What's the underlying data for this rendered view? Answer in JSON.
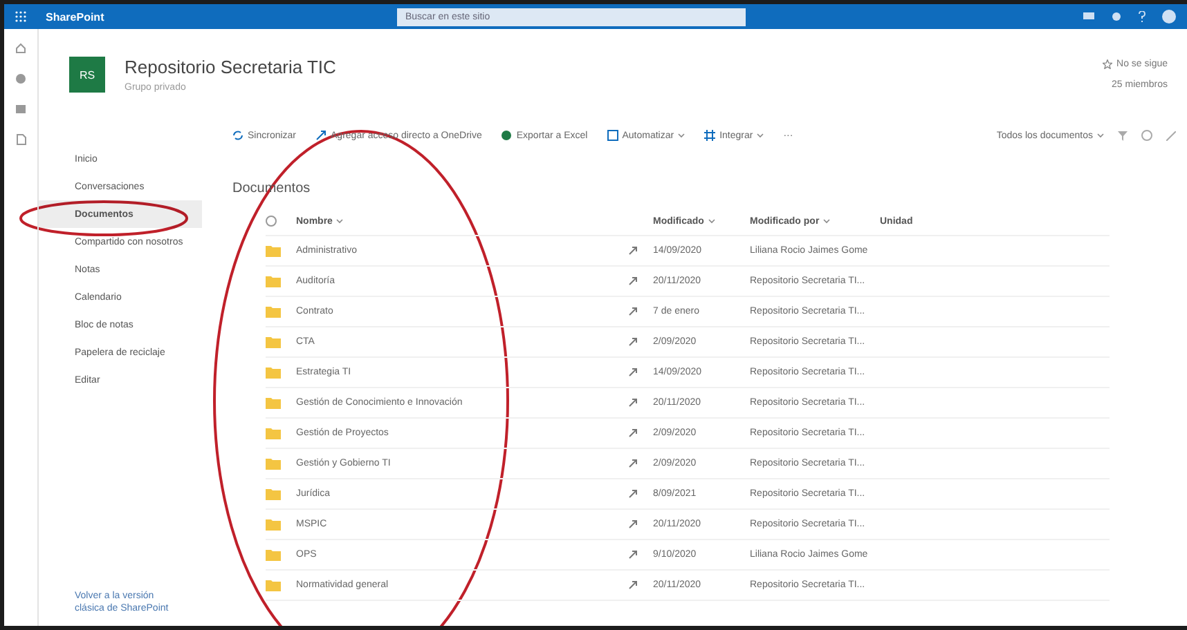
{
  "top_bar": {
    "app_name": "SharePoint",
    "search_placeholder": "Buscar en este sitio"
  },
  "site": {
    "logo": "RS",
    "title": "Repositorio Secretaria TIC",
    "subtitle": "Grupo privado",
    "follow": "No se sigue",
    "members": "25 miembros"
  },
  "nav": {
    "items": [
      {
        "label": "Inicio",
        "selected": false
      },
      {
        "label": "Conversaciones",
        "selected": false
      },
      {
        "label": "Documentos",
        "selected": true
      },
      {
        "label": "Compartido con nosotros",
        "selected": false
      },
      {
        "label": "Notas",
        "selected": false
      },
      {
        "label": "Calendario",
        "selected": false
      },
      {
        "label": "Bloc de notas",
        "selected": false
      },
      {
        "label": "Papelera de reciclaje",
        "selected": false
      },
      {
        "label": "Editar",
        "selected": false
      }
    ],
    "footer_link": "Volver a la versión clásica de SharePoint"
  },
  "toolbar": {
    "items": [
      {
        "kind": "sync",
        "label": "Sincronizar"
      },
      {
        "kind": "shortcut",
        "label": "Agregar acceso directo a OneDrive"
      },
      {
        "kind": "excel",
        "label": "Exportar a Excel"
      },
      {
        "kind": "automate",
        "label": "Automatizar",
        "dropdown": true
      },
      {
        "kind": "integrate",
        "label": "Integrar",
        "dropdown": true
      },
      {
        "kind": "more",
        "label": "···"
      }
    ],
    "view": "Todos los documentos"
  },
  "library_title": "Documentos",
  "columns": [
    "Nombre",
    "Modificado",
    "Modificado por",
    "Unidad"
  ],
  "rows": [
    {
      "name": "Administrativo",
      "modified": "14/09/2020",
      "modified_by": "Liliana Rocio Jaimes Gome"
    },
    {
      "name": "Auditoría",
      "modified": "20/11/2020",
      "modified_by": "Repositorio Secretaria TI..."
    },
    {
      "name": "Contrato",
      "modified": "7 de enero",
      "modified_by": "Repositorio Secretaria TI..."
    },
    {
      "name": "CTA",
      "modified": "2/09/2020",
      "modified_by": "Repositorio Secretaria TI..."
    },
    {
      "name": "Estrategia TI",
      "modified": "14/09/2020",
      "modified_by": "Repositorio Secretaria TI..."
    },
    {
      "name": "Gestión de Conocimiento e Innovación",
      "modified": "20/11/2020",
      "modified_by": "Repositorio Secretaria TI..."
    },
    {
      "name": "Gestión de Proyectos",
      "modified": "2/09/2020",
      "modified_by": "Repositorio Secretaria TI..."
    },
    {
      "name": "Gestión y Gobierno TI",
      "modified": "2/09/2020",
      "modified_by": "Repositorio Secretaria TI..."
    },
    {
      "name": "Jurídica",
      "modified": "8/09/2021",
      "modified_by": "Repositorio Secretaria TI..."
    },
    {
      "name": "MSPIC",
      "modified": "20/11/2020",
      "modified_by": "Repositorio Secretaria TI..."
    },
    {
      "name": "OPS",
      "modified": "9/10/2020",
      "modified_by": "Liliana Rocio Jaimes Gome"
    },
    {
      "name": "Normatividad general",
      "modified": "20/11/2020",
      "modified_by": "Repositorio Secretaria TI..."
    }
  ]
}
